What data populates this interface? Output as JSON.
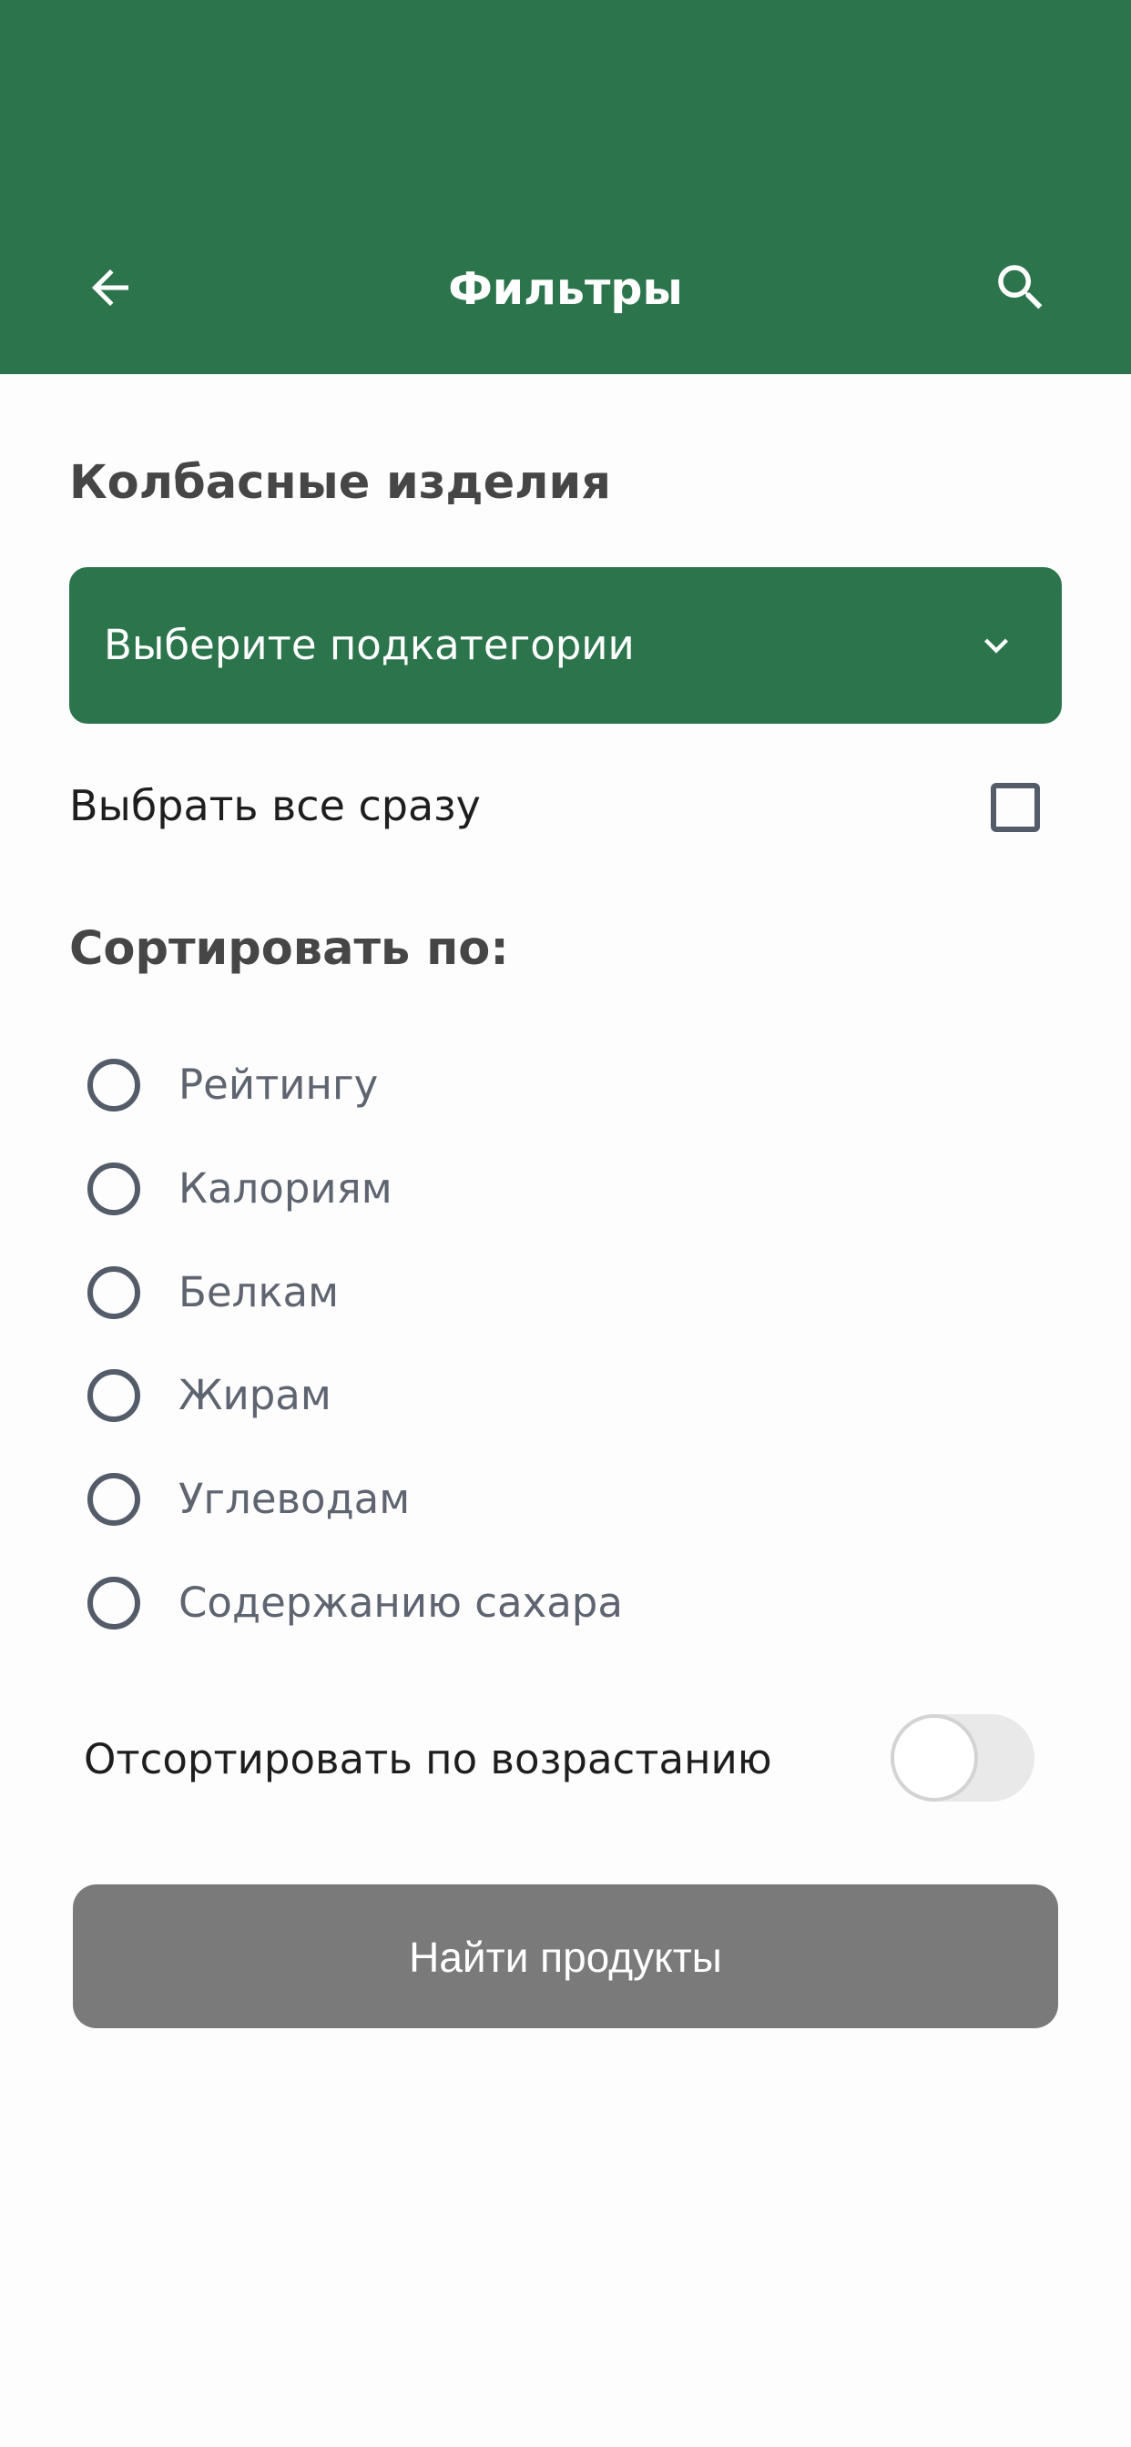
{
  "header": {
    "title": "Фильтры",
    "back_icon": "arrow-left-icon",
    "search_icon": "search-icon",
    "background_color": "#2c754c"
  },
  "category": {
    "title": "Колбасные изделия"
  },
  "subcategory_dropdown": {
    "label": "Выберите подкатегории",
    "icon": "chevron-down-icon"
  },
  "select_all": {
    "label": "Выбрать все сразу",
    "checked": false
  },
  "sort": {
    "title": "Сортировать по:",
    "options": [
      {
        "label": "Рейтингу",
        "selected": false
      },
      {
        "label": "Калориям",
        "selected": false
      },
      {
        "label": "Белкам",
        "selected": false
      },
      {
        "label": "Жирам",
        "selected": false
      },
      {
        "label": "Углеводам",
        "selected": false
      },
      {
        "label": "Содержанию сахара",
        "selected": false
      }
    ]
  },
  "ascending": {
    "label": "Отсортировать по возрастанию",
    "enabled": false
  },
  "find_button": {
    "label": "Найти продукты",
    "color": "#7a7a7a"
  }
}
